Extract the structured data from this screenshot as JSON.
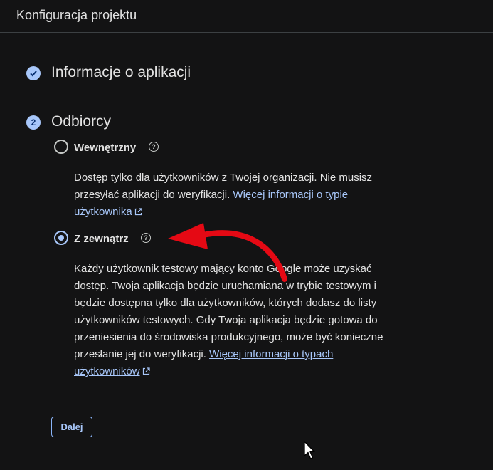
{
  "header": {
    "title": "Konfiguracja projektu"
  },
  "steps": [
    {
      "number": "",
      "title": "Informacje o aplikacji",
      "status": "done"
    },
    {
      "number": "2",
      "title": "Odbiorcy",
      "status": "active"
    }
  ],
  "audience": {
    "internal": {
      "label": "Wewnętrzny",
      "description": "Dostęp tylko dla użytkowników z Twojej organizacji. Nie musisz przesyłać aplikacji do weryfikacji.",
      "link": "Więcej informacji o typie użytkownika"
    },
    "external": {
      "label": "Z zewnątrz",
      "description": "Każdy użytkownik testowy mający konto Google może uzyskać dostęp. Twoja aplikacja będzie uruchamiana w trybie testowym i będzie dostępna tylko dla użytkowników, których dodasz do listy użytkowników testowych. Gdy Twoja aplikacja będzie gotowa do przeniesienia do środowiska produkcyjnego, może być konieczne przesłanie jej do weryfikacji.",
      "link": "Więcej informacji o typach użytkowników"
    },
    "selected": "external"
  },
  "actions": {
    "next_label": "Dalej"
  },
  "colors": {
    "accent": "#a8c7fa",
    "background": "#131314",
    "arrow": "#e50914"
  }
}
